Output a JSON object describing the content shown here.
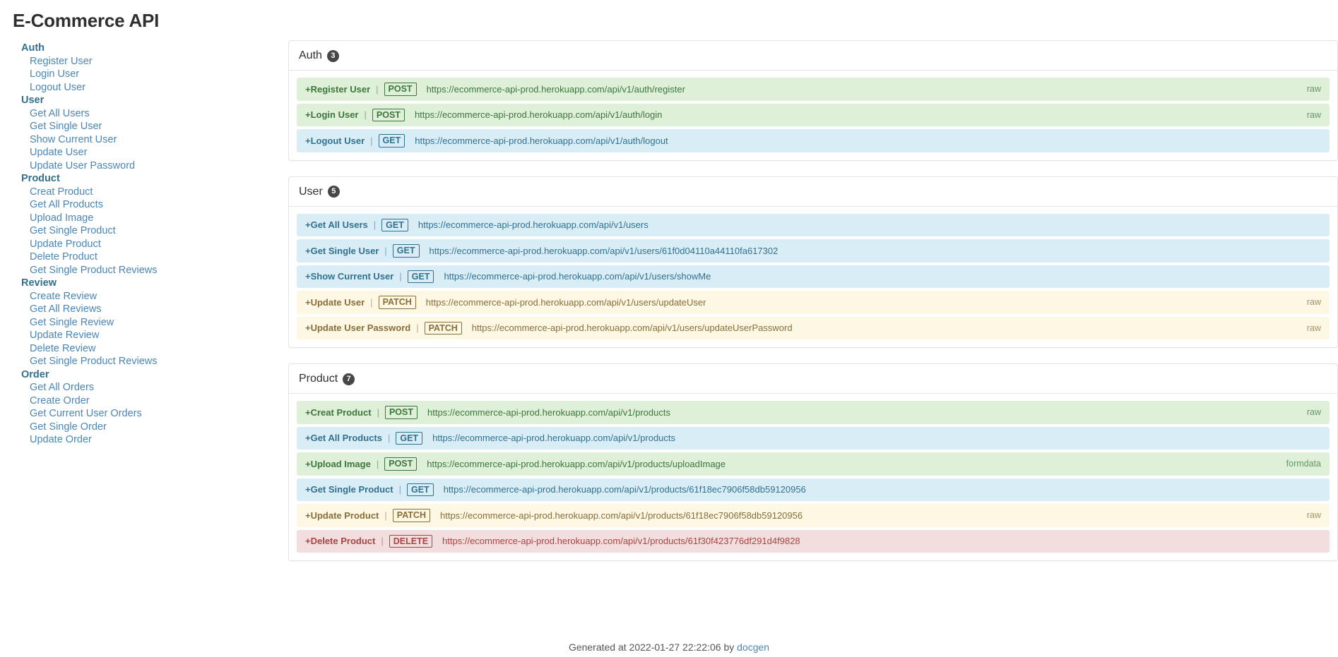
{
  "page": {
    "title": "E-Commerce API"
  },
  "sidebar": {
    "groups": [
      {
        "title": "Auth",
        "items": [
          {
            "label": "Register User"
          },
          {
            "label": "Login User"
          },
          {
            "label": "Logout User"
          }
        ]
      },
      {
        "title": "User",
        "items": [
          {
            "label": "Get All Users"
          },
          {
            "label": "Get Single User"
          },
          {
            "label": "Show Current User"
          },
          {
            "label": "Update User"
          },
          {
            "label": "Update User Password"
          }
        ]
      },
      {
        "title": "Product",
        "items": [
          {
            "label": "Creat Product"
          },
          {
            "label": "Get All Products"
          },
          {
            "label": "Upload Image"
          },
          {
            "label": "Get Single Product"
          },
          {
            "label": "Update Product"
          },
          {
            "label": "Delete Product"
          },
          {
            "label": "Get Single Product Reviews"
          }
        ]
      },
      {
        "title": "Review",
        "items": [
          {
            "label": "Create Review"
          },
          {
            "label": "Get All Reviews"
          },
          {
            "label": "Get Single Review"
          },
          {
            "label": "Update Review"
          },
          {
            "label": "Delete Review"
          },
          {
            "label": "Get Single Product Reviews"
          }
        ]
      },
      {
        "title": "Order",
        "items": [
          {
            "label": "Get All Orders"
          },
          {
            "label": "Create Order"
          },
          {
            "label": "Get Current User Orders"
          },
          {
            "label": "Get Single Order"
          },
          {
            "label": "Update Order"
          }
        ]
      }
    ]
  },
  "main": {
    "sections": [
      {
        "title": "Auth",
        "count": "3",
        "endpoints": [
          {
            "expander": "+",
            "name": "Register User",
            "separator": "|",
            "method": "POST",
            "url": "https://ecommerce-api-prod.herokuapp.com/api/v1/auth/register",
            "body_type": "raw"
          },
          {
            "expander": "+",
            "name": "Login User",
            "separator": "|",
            "method": "POST",
            "url": "https://ecommerce-api-prod.herokuapp.com/api/v1/auth/login",
            "body_type": "raw"
          },
          {
            "expander": "+",
            "name": "Logout User",
            "separator": "|",
            "method": "GET",
            "url": "https://ecommerce-api-prod.herokuapp.com/api/v1/auth/logout",
            "body_type": ""
          }
        ]
      },
      {
        "title": "User",
        "count": "5",
        "endpoints": [
          {
            "expander": "+",
            "name": "Get All Users",
            "separator": "|",
            "method": "GET",
            "url": "https://ecommerce-api-prod.herokuapp.com/api/v1/users",
            "body_type": ""
          },
          {
            "expander": "+",
            "name": "Get Single User",
            "separator": "|",
            "method": "GET",
            "url": "https://ecommerce-api-prod.herokuapp.com/api/v1/users/61f0d04110a44110fa617302",
            "body_type": ""
          },
          {
            "expander": "+",
            "name": "Show Current User",
            "separator": "|",
            "method": "GET",
            "url": "https://ecommerce-api-prod.herokuapp.com/api/v1/users/showMe",
            "body_type": ""
          },
          {
            "expander": "+",
            "name": "Update User",
            "separator": "|",
            "method": "PATCH",
            "url": "https://ecommerce-api-prod.herokuapp.com/api/v1/users/updateUser",
            "body_type": "raw"
          },
          {
            "expander": "+",
            "name": "Update User Password",
            "separator": "|",
            "method": "PATCH",
            "url": "https://ecommerce-api-prod.herokuapp.com/api/v1/users/updateUserPassword",
            "body_type": "raw"
          }
        ]
      },
      {
        "title": "Product",
        "count": "7",
        "endpoints": [
          {
            "expander": "+",
            "name": "Creat Product",
            "separator": "|",
            "method": "POST",
            "url": "https://ecommerce-api-prod.herokuapp.com/api/v1/products",
            "body_type": "raw"
          },
          {
            "expander": "+",
            "name": "Get All Products",
            "separator": "|",
            "method": "GET",
            "url": "https://ecommerce-api-prod.herokuapp.com/api/v1/products",
            "body_type": ""
          },
          {
            "expander": "+",
            "name": "Upload Image",
            "separator": "|",
            "method": "POST",
            "url": "https://ecommerce-api-prod.herokuapp.com/api/v1/products/uploadImage",
            "body_type": "formdata"
          },
          {
            "expander": "+",
            "name": "Get Single Product",
            "separator": "|",
            "method": "GET",
            "url": "https://ecommerce-api-prod.herokuapp.com/api/v1/products/61f18ec7906f58db59120956",
            "body_type": ""
          },
          {
            "expander": "+",
            "name": "Update Product",
            "separator": "|",
            "method": "PATCH",
            "url": "https://ecommerce-api-prod.herokuapp.com/api/v1/products/61f18ec7906f58db59120956",
            "body_type": "raw"
          },
          {
            "expander": "+",
            "name": "Delete Product",
            "separator": "|",
            "method": "DELETE",
            "url": "https://ecommerce-api-prod.herokuapp.com/api/v1/products/61f30f423776df291d4f9828",
            "body_type": ""
          }
        ]
      }
    ]
  },
  "footer": {
    "prefix": "Generated at 2022-01-27 22:22:06 by",
    "link": "docgen"
  },
  "colors": {
    "get": "#d9edf7",
    "get_text": "#31708f",
    "post": "#dff0d8",
    "post_text": "#3c763d",
    "patch": "#fcf8e3",
    "patch_text": "#8a6d3b",
    "delete": "#f2dede",
    "delete_text": "#a94442",
    "badge": "#474747",
    "link": "#4a86b8"
  }
}
